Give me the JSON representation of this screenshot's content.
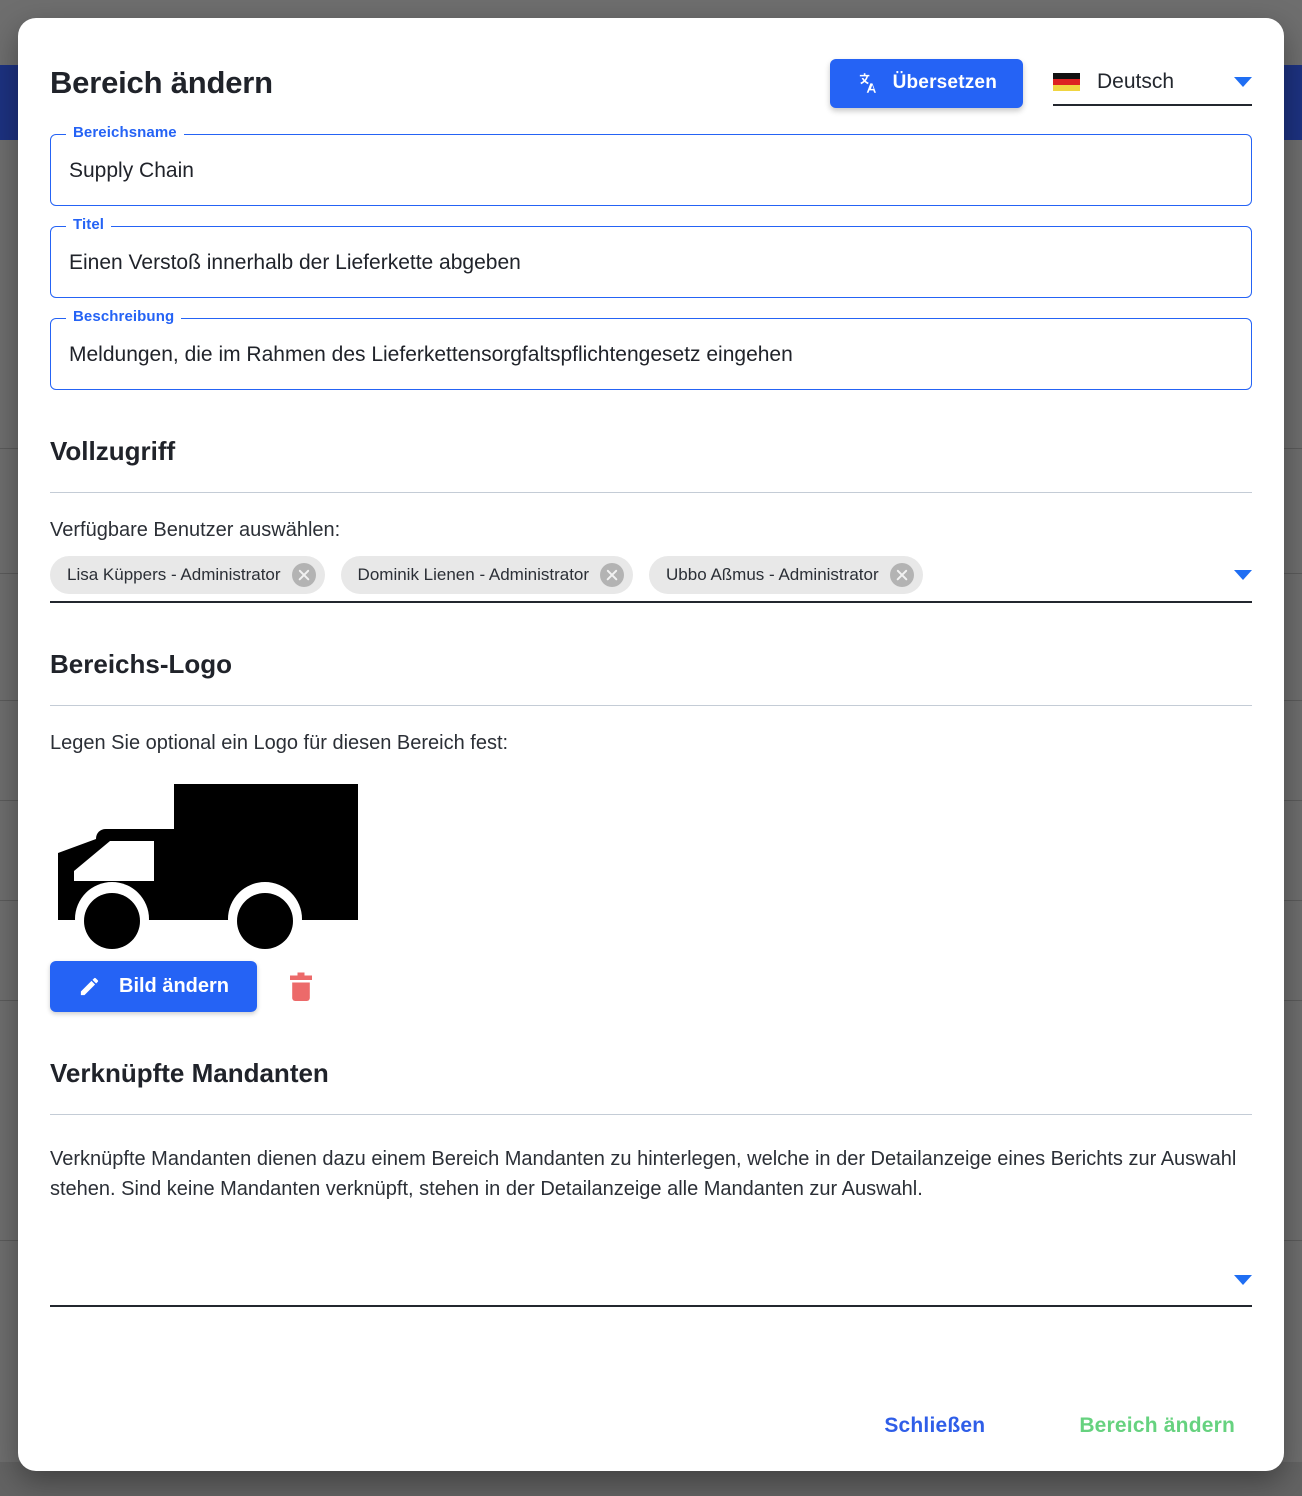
{
  "dialog": {
    "title": "Bereich ändern",
    "translate_button": {
      "label": "Übersetzen",
      "icon": "translate-icon",
      "color": "#2563f5"
    },
    "language_selector": {
      "value": "Deutsch",
      "flag": "flag-de-icon",
      "caret": "chevron-down-icon"
    },
    "fields": [
      {
        "label": "Bereichsname",
        "value": "Supply Chain"
      },
      {
        "label": "Titel",
        "value": "Einen Verstoß innerhalb der Lieferkette abgeben"
      },
      {
        "label": "Beschreibung",
        "value": "Meldungen, die im Rahmen des Lieferkettensorgfaltspflichtengesetz eingehen"
      }
    ],
    "full_access": {
      "heading": "Vollzugriff",
      "hint": "Verfügbare Benutzer auswählen:",
      "chips": [
        "Lisa Küppers - Administrator",
        "Dominik Lienen - Administrator",
        "Ubbo Aßmus - Administrator"
      ]
    },
    "area_logo": {
      "heading": "Bereichs-Logo",
      "hint": "Legen Sie optional ein Logo für diesen Bereich fest:",
      "logo_icon": "truck-logo",
      "change_image_button": {
        "label": "Bild ändern",
        "icon": "pencil-icon"
      },
      "delete_icon": "trash-icon",
      "delete_color": "#ec6a6a"
    },
    "linked_clients": {
      "heading": "Verknüpfte Mandanten",
      "description": "Verknüpfte Mandanten dienen dazu einem Bereich Mandanten zu hinterlegen, welche in der Detailanzeige eines Berichts zur Auswahl stehen. Sind keine Mandanten verknüpft, stehen in der Detailanzeige alle Mandanten zur Auswahl.",
      "select_value": "",
      "caret": "chevron-down-icon"
    },
    "footer": {
      "close_label": "Schließen",
      "confirm_label": "Bereich ändern",
      "close_color": "#2f5ee8",
      "confirm_color": "#66d27f"
    }
  },
  "background": {
    "navbar_color": "#1d3281",
    "overlay_color": "#6e6e6e"
  }
}
